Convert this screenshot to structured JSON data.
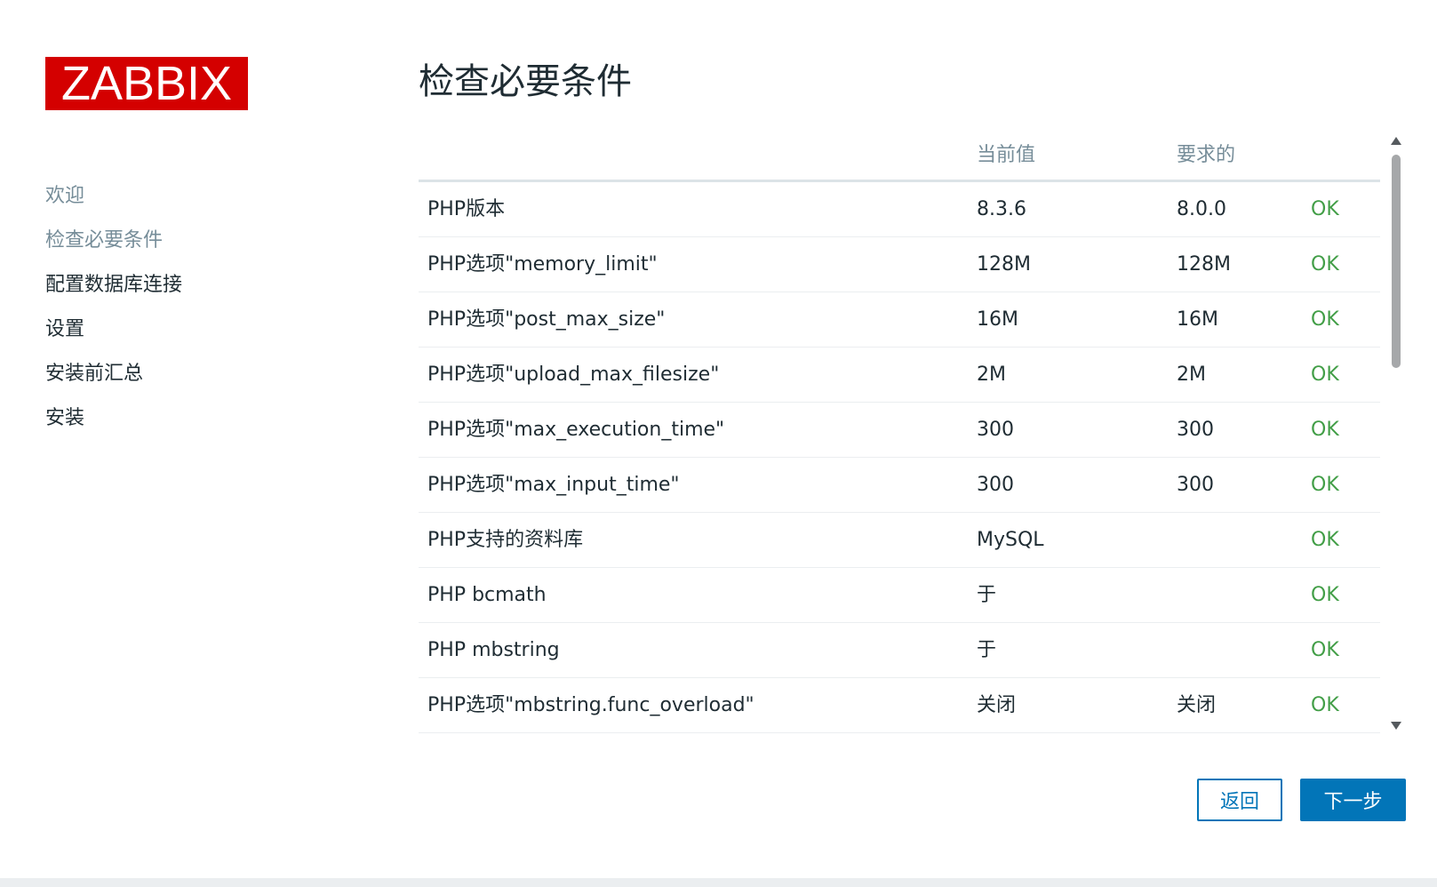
{
  "logo": {
    "text": "ZABBIX"
  },
  "sidebar": {
    "items": [
      {
        "label": "欢迎",
        "state": "done"
      },
      {
        "label": "检查必要条件",
        "state": "current"
      },
      {
        "label": "配置数据库连接",
        "state": "pending"
      },
      {
        "label": "设置",
        "state": "pending"
      },
      {
        "label": "安装前汇总",
        "state": "pending"
      },
      {
        "label": "安装",
        "state": "pending"
      }
    ]
  },
  "main": {
    "title": "检查必要条件",
    "table": {
      "headers": {
        "name": "",
        "current": "当前值",
        "required": "要求的",
        "result": ""
      },
      "rows": [
        {
          "name": "PHP版本",
          "current": "8.3.6",
          "required": "8.0.0",
          "result": "OK"
        },
        {
          "name": "PHP选项\"memory_limit\"",
          "current": "128M",
          "required": "128M",
          "result": "OK"
        },
        {
          "name": "PHP选项\"post_max_size\"",
          "current": "16M",
          "required": "16M",
          "result": "OK"
        },
        {
          "name": "PHP选项\"upload_max_filesize\"",
          "current": "2M",
          "required": "2M",
          "result": "OK"
        },
        {
          "name": "PHP选项\"max_execution_time\"",
          "current": "300",
          "required": "300",
          "result": "OK"
        },
        {
          "name": "PHP选项\"max_input_time\"",
          "current": "300",
          "required": "300",
          "result": "OK"
        },
        {
          "name": "PHP支持的资料库",
          "current": "MySQL",
          "required": "",
          "result": "OK"
        },
        {
          "name": "PHP bcmath",
          "current": "于",
          "required": "",
          "result": "OK"
        },
        {
          "name": "PHP mbstring",
          "current": "于",
          "required": "",
          "result": "OK"
        },
        {
          "name": "PHP选项\"mbstring.func_overload\"",
          "current": "关闭",
          "required": "关闭",
          "result": "OK"
        }
      ]
    }
  },
  "buttons": {
    "back": "返回",
    "next": "下一步"
  },
  "colors": {
    "brand": "#d40000",
    "accent": "#0275b8",
    "ok": "#429e47",
    "muted": "#768d99"
  }
}
